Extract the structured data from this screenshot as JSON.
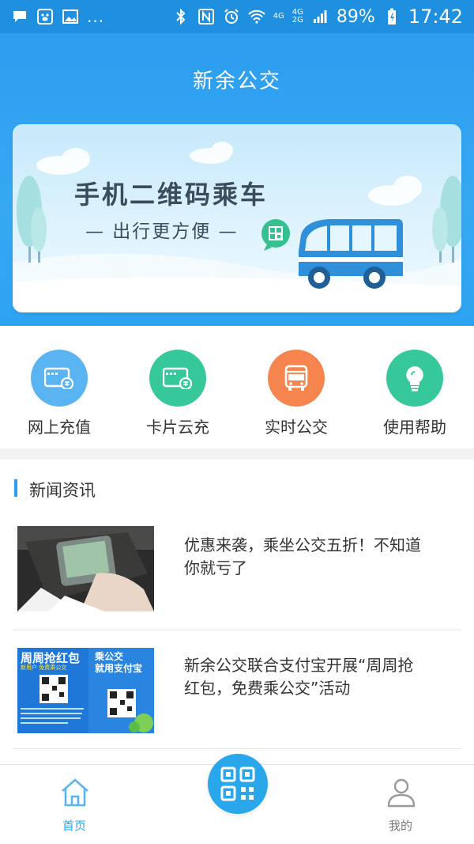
{
  "status_bar": {
    "left_icons": [
      "chat-icon",
      "baidu-icon",
      "image-icon"
    ],
    "more": "...",
    "network_top": "4G",
    "network_dual_top": "4G",
    "network_dual_bottom": "2G",
    "battery": "89%",
    "time": "17:42"
  },
  "header": {
    "title": "新余公交"
  },
  "banner": {
    "title": "手机二维码乘车",
    "subtitle": "— 出行更方便 —"
  },
  "actions": [
    {
      "label": "网上充值",
      "icon": "card-recharge-icon",
      "color": "#5ab4f2"
    },
    {
      "label": "卡片云充",
      "icon": "card-cloud-icon",
      "color": "#36c79a"
    },
    {
      "label": "实时公交",
      "icon": "bus-icon",
      "color": "#f5844e"
    },
    {
      "label": "使用帮助",
      "icon": "lightbulb-icon",
      "color": "#36c79a"
    }
  ],
  "news": {
    "section_title": "新闻资讯",
    "items": [
      {
        "title": "优惠来袭，乘坐公交五折！不知道你就亏了"
      },
      {
        "title": "新余公交联合支付宝开展“周周抢红包，免费乘公交”活动",
        "poster_left_title": "周周抢红包",
        "poster_left_sub": "新用户 免费乘公交",
        "poster_right_title_1": "乘公交",
        "poster_right_title_2": "就用支付宝"
      }
    ]
  },
  "bottom_nav": {
    "home": "首页",
    "mine": "我的"
  },
  "colors": {
    "primary": "#2d9df0",
    "nav_active": "#2aa6ea"
  }
}
